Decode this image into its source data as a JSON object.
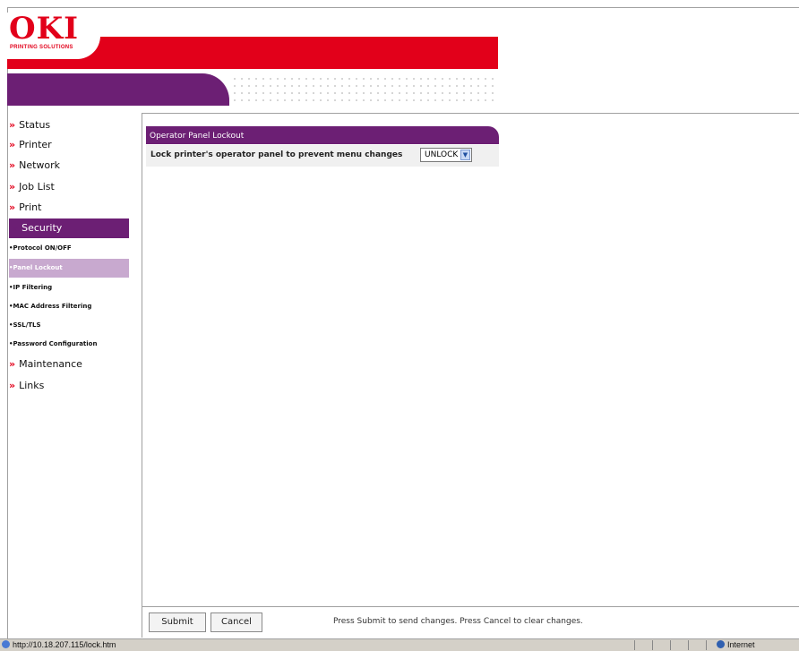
{
  "brand": {
    "logo": "OKI",
    "subtitle": "PRINTING SOLUTIONS"
  },
  "sidebar": {
    "items": [
      {
        "label": "Status"
      },
      {
        "label": "Printer"
      },
      {
        "label": "Network"
      },
      {
        "label": "Job List"
      },
      {
        "label": "Print"
      }
    ],
    "security": {
      "label": "Security"
    },
    "sub_items": [
      {
        "label": "•Protocol ON/OFF"
      },
      {
        "label": "•Panel Lockout"
      },
      {
        "label": "•IP Filtering"
      },
      {
        "label": "•MAC Address Filtering"
      },
      {
        "label": "•SSL/TLS"
      },
      {
        "label": "•Password Configuration"
      }
    ],
    "items_after": [
      {
        "label": "Maintenance"
      },
      {
        "label": "Links"
      }
    ],
    "chevron": "»"
  },
  "main": {
    "panel_title": "Operator Panel Lockout",
    "setting_label": "Lock printer's operator panel to prevent menu changes",
    "select_value": "UNLOCK"
  },
  "footer": {
    "submit_label": "Submit",
    "cancel_label": "Cancel",
    "hint": "Press Submit to send changes. Press Cancel to clear changes."
  },
  "statusbar": {
    "url": "http://10.18.207.115/lock.htm",
    "zone": "Internet"
  },
  "colors": {
    "brand_red": "#e2001a",
    "brand_purple": "#6c1f74",
    "active_sub": "#c8a9cf"
  }
}
